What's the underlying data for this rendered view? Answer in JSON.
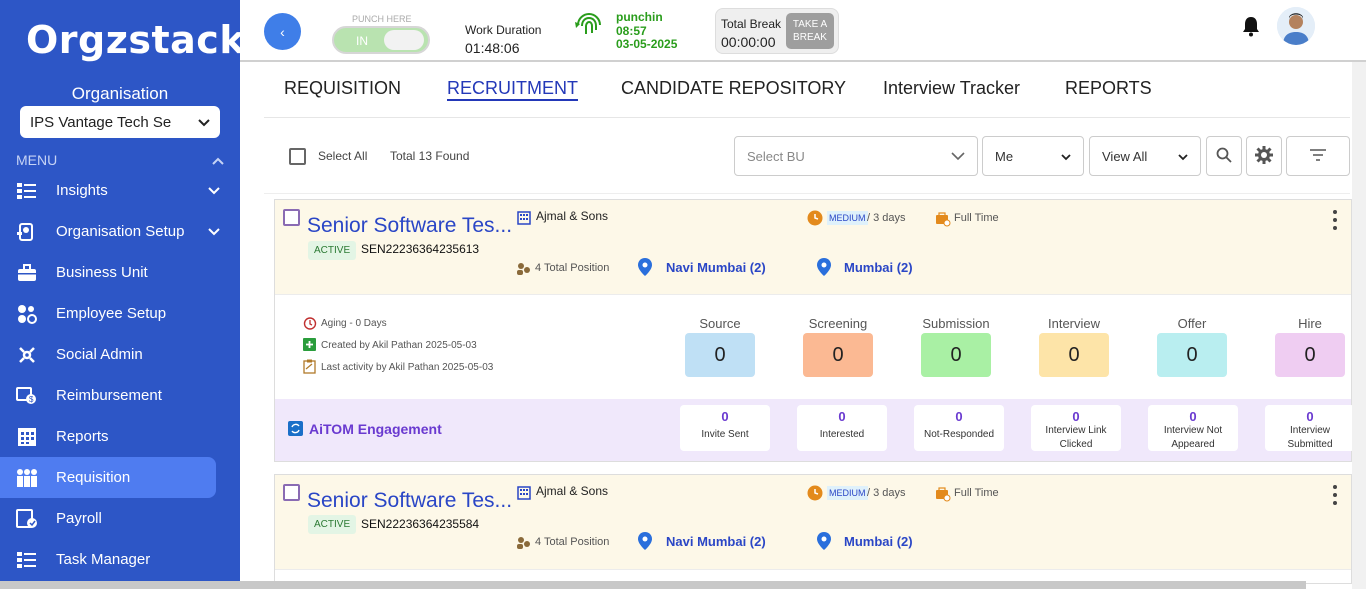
{
  "sidebar": {
    "logo": "Orgzstack",
    "org_label": "Organisation",
    "org_select": "IPS Vantage Tech Se",
    "menu_label": "MENU",
    "items": [
      {
        "label": "Insights",
        "icon": "insights-icon",
        "chevron": true
      },
      {
        "label": "Organisation Setup",
        "icon": "organisation-setup-icon",
        "chevron": true
      },
      {
        "label": "Business Unit",
        "icon": "briefcase-icon",
        "chevron": false
      },
      {
        "label": "Employee Setup",
        "icon": "employee-setup-icon",
        "chevron": false
      },
      {
        "label": "Social Admin",
        "icon": "social-admin-icon",
        "chevron": false
      },
      {
        "label": "Reimbursement",
        "icon": "reimbursement-icon",
        "chevron": false
      },
      {
        "label": "Reports",
        "icon": "reports-grid-icon",
        "chevron": false
      },
      {
        "label": "Requisition",
        "icon": "requisition-icon",
        "chevron": false,
        "active": true
      },
      {
        "label": "Payroll",
        "icon": "payroll-icon",
        "chevron": false
      },
      {
        "label": "Task Manager",
        "icon": "task-manager-icon",
        "chevron": false
      }
    ]
  },
  "topbar": {
    "punch_here": "PUNCH HERE",
    "punch_state": "IN",
    "work_duration_label": "Work Duration",
    "work_duration": "01:48:06",
    "punchin_label": "punchin",
    "punchin_time": "08:57",
    "punchin_date": "03-05-2025",
    "total_break_label": "Total Break",
    "total_break": "00:00:00",
    "take_break_line1": "TAKE A",
    "take_break_line2": "BREAK"
  },
  "tabs": [
    "REQUISITION",
    "RECRUITMENT",
    "CANDIDATE REPOSITORY",
    "Interview Tracker",
    "REPORTS"
  ],
  "active_tab": "RECRUITMENT",
  "filters": {
    "select_all": "Select All",
    "total_found": "Total 13 Found",
    "bu_placeholder": "Select BU",
    "owner": "Me",
    "view": "View All"
  },
  "cards": [
    {
      "title": "Senior Software Tes...",
      "status": "ACTIVE",
      "code": "SEN22236364235613",
      "client": "Ajmal & Sons",
      "priority": "MEDIUM",
      "duration": "/ 3 days",
      "job_type": "Full Time",
      "positions": "4 Total Position",
      "loc1": "Navi Mumbai (2)",
      "loc2": "Mumbai (2)",
      "aging": "Aging - 0 Days",
      "created": "Created by Akil Pathan 2025-05-03",
      "last_activity": "Last activity by Akil Pathan 2025-05-03",
      "stages": [
        {
          "label": "Source",
          "value": "0",
          "color": "#bfe0f5"
        },
        {
          "label": "Screening",
          "value": "0",
          "color": "#fbb993"
        },
        {
          "label": "Submission",
          "value": "0",
          "color": "#a9f0a4"
        },
        {
          "label": "Interview",
          "value": "0",
          "color": "#fde4a8"
        },
        {
          "label": "Offer",
          "value": "0",
          "color": "#b9eef0"
        },
        {
          "label": "Hire",
          "value": "0",
          "color": "#efcdf2"
        }
      ],
      "engagement_title": "AiTOM Engagement",
      "engagement": [
        {
          "num": "0",
          "label1": "Invite Sent",
          "label2": ""
        },
        {
          "num": "0",
          "label1": "Interested",
          "label2": ""
        },
        {
          "num": "0",
          "label1": "Not-Responded",
          "label2": ""
        },
        {
          "num": "0",
          "label1": "Interview Link",
          "label2": "Clicked"
        },
        {
          "num": "0",
          "label1": "Interview Not",
          "label2": "Appeared"
        },
        {
          "num": "0",
          "label1": "Interview",
          "label2": "Submitted"
        }
      ]
    },
    {
      "title": "Senior Software Tes...",
      "status": "ACTIVE",
      "code": "SEN22236364235584",
      "client": "Ajmal & Sons",
      "priority": "MEDIUM",
      "duration": "/ 3 days",
      "job_type": "Full Time",
      "positions": "4 Total Position",
      "loc1": "Navi Mumbai (2)",
      "loc2": "Mumbai (2)"
    }
  ]
}
